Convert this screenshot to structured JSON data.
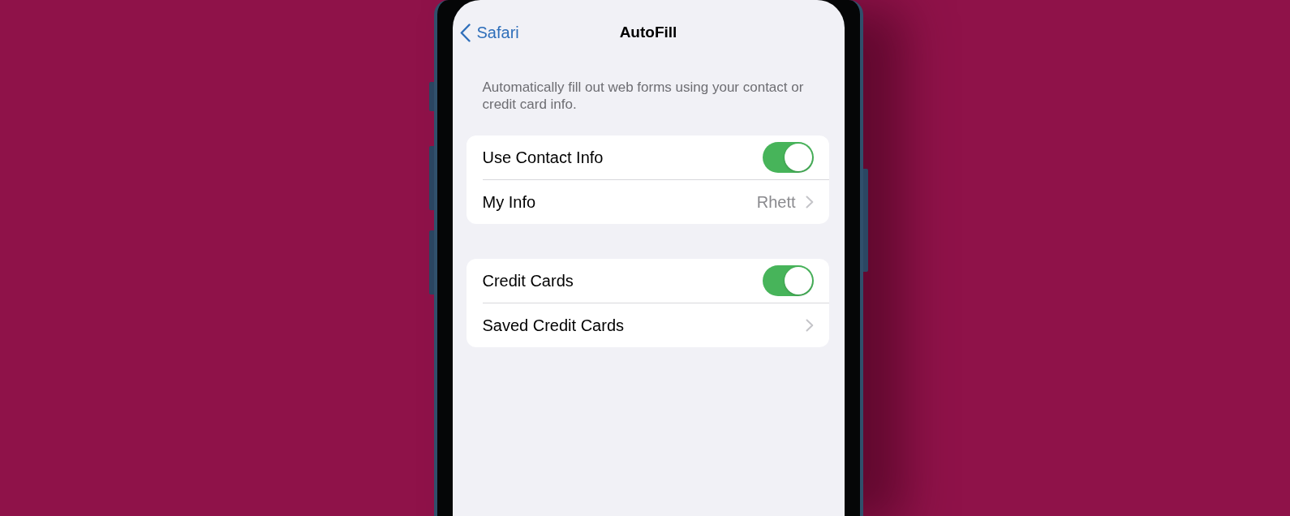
{
  "nav": {
    "back_label": "Safari",
    "title": "AutoFill"
  },
  "description": "Automatically fill out web forms using your contact or credit card info.",
  "groups": [
    {
      "rows": [
        {
          "kind": "toggle",
          "label": "Use Contact Info",
          "on": true
        },
        {
          "kind": "link",
          "label": "My Info",
          "value": "Rhett"
        }
      ]
    },
    {
      "rows": [
        {
          "kind": "toggle",
          "label": "Credit Cards",
          "on": true
        },
        {
          "kind": "link",
          "label": "Saved Credit Cards"
        }
      ]
    }
  ]
}
